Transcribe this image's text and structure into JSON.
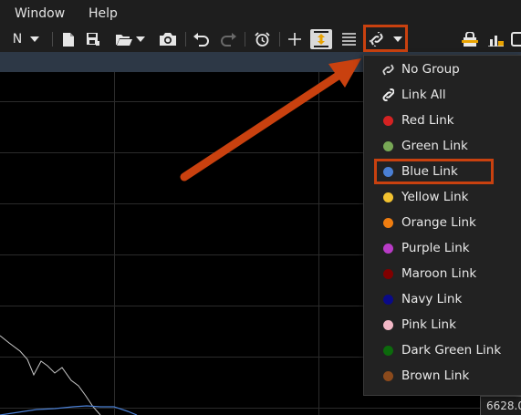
{
  "menubar": {
    "window": "Window",
    "help": "Help"
  },
  "toolbar": {
    "n_label": "N",
    "icons": [
      "chevron-down-icon",
      "new-file-icon",
      "save-icon",
      "open-folder-icon",
      "camera-icon",
      "undo-icon",
      "redo-icon",
      "alarm-icon",
      "crosshair-icon",
      "autoscale-icon",
      "menu-lines-icon",
      "link-icon",
      "lock-icon",
      "alert-icon",
      "window-icon"
    ]
  },
  "link_menu": {
    "items": [
      {
        "label": "No Group",
        "icon": "unlink-icon",
        "color": ""
      },
      {
        "label": "Link All",
        "icon": "link-icon",
        "color": ""
      },
      {
        "label": "Red Link",
        "icon": "dot",
        "color": "#d42222"
      },
      {
        "label": "Green Link",
        "icon": "dot",
        "color": "#78a856"
      },
      {
        "label": "Blue Link",
        "icon": "dot",
        "color": "#4a7fd4"
      },
      {
        "label": "Yellow Link",
        "icon": "dot",
        "color": "#f2c230"
      },
      {
        "label": "Orange Link",
        "icon": "dot",
        "color": "#ef7d10"
      },
      {
        "label": "Purple Link",
        "icon": "dot",
        "color": "#b83bc6"
      },
      {
        "label": "Maroon Link",
        "icon": "dot",
        "color": "#800000"
      },
      {
        "label": "Navy Link",
        "icon": "dot",
        "color": "#0a0a88"
      },
      {
        "label": "Pink Link",
        "icon": "dot",
        "color": "#f2b8c6"
      },
      {
        "label": "Dark Green Link",
        "icon": "dot",
        "color": "#0c6a0c"
      },
      {
        "label": "Brown Link",
        "icon": "dot",
        "color": "#8b4a1c"
      }
    ],
    "selected": "Blue Link"
  },
  "chart": {
    "price_readout": "6628.0"
  },
  "annotation": {
    "color": "#c9410f"
  }
}
